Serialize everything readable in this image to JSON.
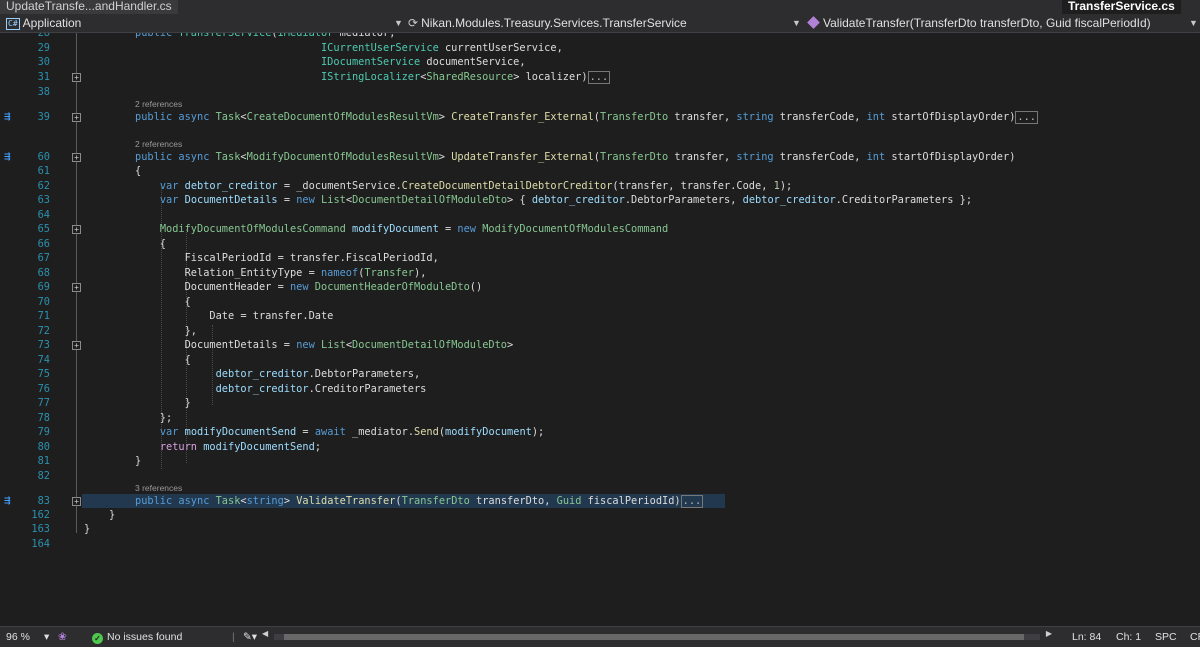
{
  "tabs": {
    "inactive_label": "UpdateTransfe...andHandler.cs",
    "active_label": "TransferService.cs"
  },
  "navbar": {
    "project_icon": "C#",
    "project": "Application",
    "namespace_icon": "namespace-icon",
    "namespace": "Nikan.Modules.Treasury.Services.TransferService",
    "member_icon": "method-icon",
    "member": "ValidateTransfer(TransferDto transferDto, Guid fiscalPeriodId)"
  },
  "codelens": {
    "refs_39": "2 references",
    "refs_60": "2 references",
    "refs_83": "3 references"
  },
  "ellipsis": "...",
  "lines": [
    {
      "n": "28",
      "tokens": [
        {
          "c": "kw",
          "t": "public "
        },
        {
          "c": "ty",
          "t": "TransferService"
        },
        {
          "c": "pl",
          "t": "("
        },
        {
          "c": "ty",
          "t": "IMediator"
        },
        {
          "c": "pl",
          "t": " mediator,"
        }
      ]
    },
    {
      "n": "29",
      "tokens": [
        {
          "c": "pl",
          "t": "                              "
        },
        {
          "c": "ty",
          "t": "ICurrentUserService"
        },
        {
          "c": "pl",
          "t": " currentUserService,"
        }
      ]
    },
    {
      "n": "30",
      "tokens": [
        {
          "c": "pl",
          "t": "                              "
        },
        {
          "c": "ty",
          "t": "IDocumentService"
        },
        {
          "c": "pl",
          "t": " documentService,"
        }
      ]
    },
    {
      "n": "31",
      "tokens": [
        {
          "c": "pl",
          "t": "                              "
        },
        {
          "c": "ty",
          "t": "IStringLocalizer"
        },
        {
          "c": "pl",
          "t": "<"
        },
        {
          "c": "cls",
          "t": "SharedResource"
        },
        {
          "c": "pl",
          "t": "> localizer)"
        }
      ]
    },
    {
      "n": "38",
      "tokens": []
    },
    {
      "n": "39",
      "tokens": [
        {
          "c": "kw",
          "t": "public async "
        },
        {
          "c": "cls",
          "t": "Task"
        },
        {
          "c": "pl",
          "t": "<"
        },
        {
          "c": "cls",
          "t": "CreateDocumentOfModulesResultVm"
        },
        {
          "c": "pl",
          "t": "> "
        },
        {
          "c": "mt",
          "t": "CreateTransfer_External"
        },
        {
          "c": "pl",
          "t": "("
        },
        {
          "c": "cls",
          "t": "TransferDto"
        },
        {
          "c": "pl",
          "t": " transfer, "
        },
        {
          "c": "kw",
          "t": "string"
        },
        {
          "c": "pl",
          "t": " transferCode, "
        },
        {
          "c": "kw",
          "t": "int"
        },
        {
          "c": "pl",
          "t": " startOfDisplayOrder)"
        }
      ]
    },
    {
      "n": "60",
      "tokens": [
        {
          "c": "kw",
          "t": "public async "
        },
        {
          "c": "cls",
          "t": "Task"
        },
        {
          "c": "pl",
          "t": "<"
        },
        {
          "c": "cls",
          "t": "ModifyDocumentOfModulesResultVm"
        },
        {
          "c": "pl",
          "t": "> "
        },
        {
          "c": "mt",
          "t": "UpdateTransfer_External"
        },
        {
          "c": "pl",
          "t": "("
        },
        {
          "c": "cls",
          "t": "TransferDto"
        },
        {
          "c": "pl",
          "t": " transfer, "
        },
        {
          "c": "kw",
          "t": "string"
        },
        {
          "c": "pl",
          "t": " transferCode, "
        },
        {
          "c": "kw",
          "t": "int"
        },
        {
          "c": "pl",
          "t": " startOfDisplayOrder)"
        }
      ]
    },
    {
      "n": "61",
      "tokens": [
        {
          "c": "pl",
          "t": "{"
        }
      ]
    },
    {
      "n": "62",
      "tokens": [
        {
          "c": "pl",
          "t": "    "
        },
        {
          "c": "kw",
          "t": "var"
        },
        {
          "c": "pl",
          "t": " "
        },
        {
          "c": "lc",
          "t": "debtor_creditor"
        },
        {
          "c": "pl",
          "t": " = "
        },
        {
          "c": "fld",
          "t": "_documentService"
        },
        {
          "c": "pl",
          "t": "."
        },
        {
          "c": "mt",
          "t": "CreateDocumentDetailDebtorCreditor"
        },
        {
          "c": "pl",
          "t": "(transfer, transfer.Code, "
        },
        {
          "c": "nm",
          "t": "1"
        },
        {
          "c": "pl",
          "t": ");"
        }
      ]
    },
    {
      "n": "63",
      "tokens": [
        {
          "c": "pl",
          "t": "    "
        },
        {
          "c": "kw",
          "t": "var"
        },
        {
          "c": "pl",
          "t": " "
        },
        {
          "c": "lc",
          "t": "DocumentDetails"
        },
        {
          "c": "pl",
          "t": " = "
        },
        {
          "c": "kw",
          "t": "new"
        },
        {
          "c": "pl",
          "t": " "
        },
        {
          "c": "cls",
          "t": "List"
        },
        {
          "c": "pl",
          "t": "<"
        },
        {
          "c": "cls",
          "t": "DocumentDetailOfModuleDto"
        },
        {
          "c": "pl",
          "t": "> { "
        },
        {
          "c": "lc",
          "t": "debtor_creditor"
        },
        {
          "c": "pl",
          "t": ".DebtorParameters, "
        },
        {
          "c": "lc",
          "t": "debtor_creditor"
        },
        {
          "c": "pl",
          "t": ".CreditorParameters };"
        }
      ]
    },
    {
      "n": "64",
      "tokens": []
    },
    {
      "n": "65",
      "tokens": [
        {
          "c": "pl",
          "t": "    "
        },
        {
          "c": "cls",
          "t": "ModifyDocumentOfModulesCommand"
        },
        {
          "c": "pl",
          "t": " "
        },
        {
          "c": "lc",
          "t": "modifyDocument"
        },
        {
          "c": "pl",
          "t": " = "
        },
        {
          "c": "kw",
          "t": "new"
        },
        {
          "c": "pl",
          "t": " "
        },
        {
          "c": "cls",
          "t": "ModifyDocumentOfModulesCommand"
        }
      ]
    },
    {
      "n": "66",
      "tokens": [
        {
          "c": "pl",
          "t": "    {"
        }
      ]
    },
    {
      "n": "67",
      "tokens": [
        {
          "c": "pl",
          "t": "        FiscalPeriodId = transfer.FiscalPeriodId,"
        }
      ]
    },
    {
      "n": "68",
      "tokens": [
        {
          "c": "pl",
          "t": "        Relation_EntityType = "
        },
        {
          "c": "kw",
          "t": "nameof"
        },
        {
          "c": "pl",
          "t": "("
        },
        {
          "c": "cls",
          "t": "Transfer"
        },
        {
          "c": "pl",
          "t": "),"
        }
      ]
    },
    {
      "n": "69",
      "tokens": [
        {
          "c": "pl",
          "t": "        DocumentHeader = "
        },
        {
          "c": "kw",
          "t": "new"
        },
        {
          "c": "pl",
          "t": " "
        },
        {
          "c": "cls",
          "t": "DocumentHeaderOfModuleDto"
        },
        {
          "c": "pl",
          "t": "()"
        }
      ]
    },
    {
      "n": "70",
      "tokens": [
        {
          "c": "pl",
          "t": "        {"
        }
      ]
    },
    {
      "n": "71",
      "tokens": [
        {
          "c": "pl",
          "t": "            Date = transfer.Date"
        }
      ]
    },
    {
      "n": "72",
      "tokens": [
        {
          "c": "pl",
          "t": "        },"
        }
      ]
    },
    {
      "n": "73",
      "tokens": [
        {
          "c": "pl",
          "t": "        DocumentDetails = "
        },
        {
          "c": "kw",
          "t": "new"
        },
        {
          "c": "pl",
          "t": " "
        },
        {
          "c": "cls",
          "t": "List"
        },
        {
          "c": "pl",
          "t": "<"
        },
        {
          "c": "cls",
          "t": "DocumentDetailOfModuleDto"
        },
        {
          "c": "pl",
          "t": ">"
        }
      ]
    },
    {
      "n": "74",
      "tokens": [
        {
          "c": "pl",
          "t": "        {"
        }
      ]
    },
    {
      "n": "75",
      "tokens": [
        {
          "c": "pl",
          "t": "             "
        },
        {
          "c": "lc",
          "t": "debtor_creditor"
        },
        {
          "c": "pl",
          "t": ".DebtorParameters,"
        }
      ]
    },
    {
      "n": "76",
      "tokens": [
        {
          "c": "pl",
          "t": "             "
        },
        {
          "c": "lc",
          "t": "debtor_creditor"
        },
        {
          "c": "pl",
          "t": ".CreditorParameters"
        }
      ]
    },
    {
      "n": "77",
      "tokens": [
        {
          "c": "pl",
          "t": "        }"
        }
      ]
    },
    {
      "n": "78",
      "tokens": [
        {
          "c": "pl",
          "t": "    };"
        }
      ]
    },
    {
      "n": "79",
      "tokens": [
        {
          "c": "pl",
          "t": "    "
        },
        {
          "c": "kw",
          "t": "var"
        },
        {
          "c": "pl",
          "t": " "
        },
        {
          "c": "lc",
          "t": "modifyDocumentSend"
        },
        {
          "c": "pl",
          "t": " = "
        },
        {
          "c": "kw",
          "t": "await"
        },
        {
          "c": "pl",
          "t": " "
        },
        {
          "c": "fld",
          "t": "_mediator"
        },
        {
          "c": "pl",
          "t": "."
        },
        {
          "c": "mt",
          "t": "Send"
        },
        {
          "c": "pl",
          "t": "("
        },
        {
          "c": "lc",
          "t": "modifyDocument"
        },
        {
          "c": "pl",
          "t": ");"
        }
      ]
    },
    {
      "n": "80",
      "tokens": [
        {
          "c": "pl",
          "t": "    "
        },
        {
          "c": "kw2",
          "t": "return"
        },
        {
          "c": "pl",
          "t": " "
        },
        {
          "c": "lc",
          "t": "modifyDocumentSend"
        },
        {
          "c": "pl",
          "t": ";"
        }
      ]
    },
    {
      "n": "81",
      "tokens": [
        {
          "c": "pl",
          "t": "}"
        }
      ]
    },
    {
      "n": "82",
      "tokens": []
    },
    {
      "n": "83",
      "tokens": [
        {
          "c": "kw",
          "t": "public async "
        },
        {
          "c": "cls",
          "t": "Task"
        },
        {
          "c": "pl",
          "t": "<"
        },
        {
          "c": "kw",
          "t": "string"
        },
        {
          "c": "pl",
          "t": "> "
        },
        {
          "c": "mt",
          "t": "ValidateTransfer"
        },
        {
          "c": "pl",
          "t": "("
        },
        {
          "c": "cls",
          "t": "TransferDto"
        },
        {
          "c": "pl",
          "t": " transferDto, "
        },
        {
          "c": "cls",
          "t": "Guid"
        },
        {
          "c": "pl",
          "t": " fiscalPeriodId)"
        }
      ]
    },
    {
      "n": "162",
      "tokens": [
        {
          "c": "pl",
          "t": "}"
        }
      ]
    },
    {
      "n": "163",
      "tokens": [
        {
          "c": "pl",
          "t": "}"
        }
      ]
    },
    {
      "n": "164",
      "tokens": []
    }
  ],
  "status": {
    "zoom": "96 %",
    "issues": "No issues found",
    "line": "Ln: 84",
    "col": "Ch: 1",
    "indent": "SPC",
    "eol": "CR"
  },
  "colors": {
    "editor_bg": "#1e1e1e",
    "keyword": "#569cd6",
    "type": "#4ec9b0",
    "method": "#dcdcaa",
    "local": "#9cdcfe",
    "line_number": "#2b91af"
  }
}
